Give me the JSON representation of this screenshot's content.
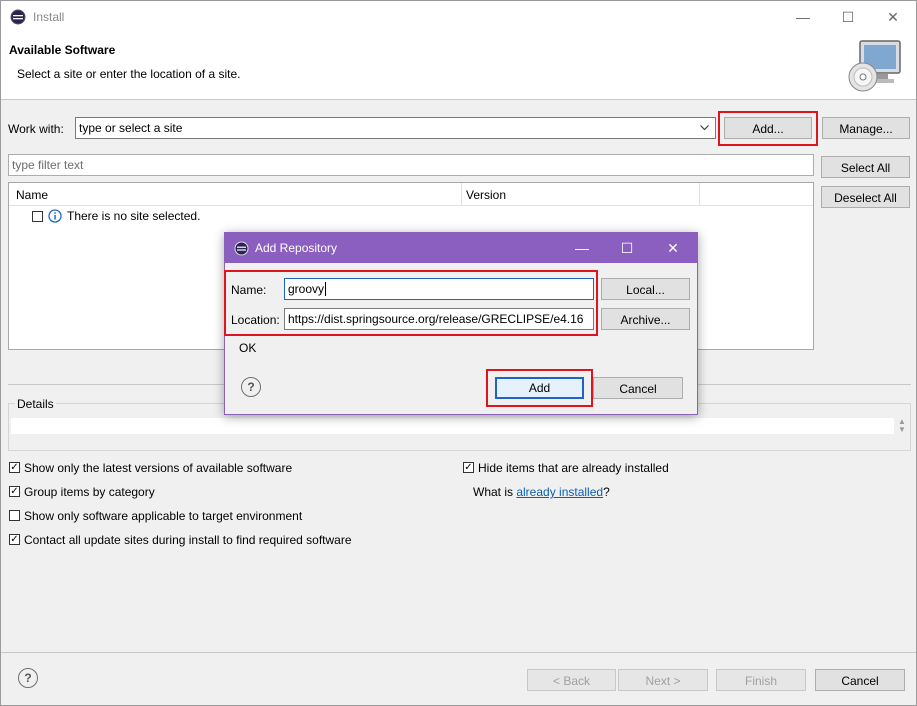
{
  "window": {
    "title": "Install",
    "minimize": "—",
    "maximize": "☐",
    "close": "✕"
  },
  "header": {
    "title": "Available Software",
    "subtitle": "Select a site or enter the location of a site."
  },
  "work_with": {
    "label": "Work with:",
    "placeholder": "type or select a site",
    "add_label": "Add...",
    "manage_label": "Manage..."
  },
  "filter": {
    "placeholder": "type filter text",
    "select_all": "Select All",
    "deselect_all": "Deselect All"
  },
  "table": {
    "columns": [
      "Name",
      "Version"
    ],
    "rows": [
      {
        "name": "There is no site selected."
      }
    ]
  },
  "details": {
    "label": "Details"
  },
  "options": {
    "show_latest": {
      "label": "Show only the latest versions of available software",
      "checked": true
    },
    "group_by_category": {
      "label": "Group items by category",
      "checked": true
    },
    "show_applicable": {
      "label": "Show only software applicable to target environment",
      "checked": false
    },
    "contact_sites": {
      "label": "Contact all update sites during install to find required software",
      "checked": true
    },
    "hide_installed": {
      "label": "Hide items that are already installed",
      "checked": true
    },
    "what_is_prefix": "What is ",
    "what_is_link": "already installed",
    "what_is_suffix": "?"
  },
  "footer": {
    "back": "< Back",
    "next": "Next >",
    "finish": "Finish",
    "cancel": "Cancel"
  },
  "dialog": {
    "title": "Add Repository",
    "name_label": "Name:",
    "name_value": "groovy",
    "location_label": "Location:",
    "location_value": "https://dist.springsource.org/release/GRECLIPSE/e4.16",
    "local_label": "Local...",
    "archive_label": "Archive...",
    "status": "OK",
    "add_label": "Add",
    "cancel_label": "Cancel"
  },
  "colors": {
    "highlight": "#e0141e",
    "dialog_title_bg": "#8b5fbf",
    "link": "#0a5fb4"
  }
}
